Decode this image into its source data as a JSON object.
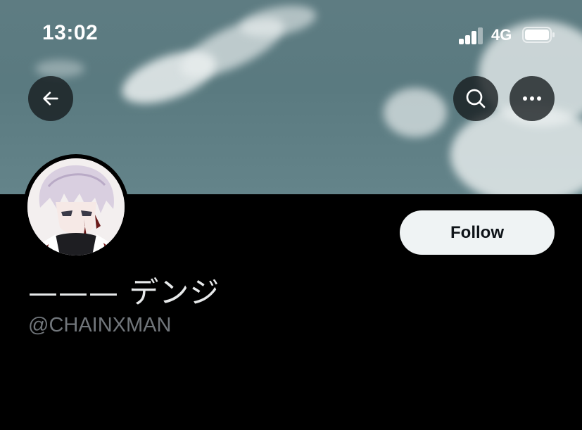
{
  "status_bar": {
    "time": "13:02",
    "network": "4G",
    "icons": [
      "signal-icon",
      "battery-icon"
    ]
  },
  "header": {
    "back_icon": "arrow-left-icon",
    "search_icon": "search-icon",
    "more_icon": "more-horizontal-icon"
  },
  "profile": {
    "display_name": "——— デンジ",
    "handle": "@CHAINXMAN",
    "follow_label": "Follow"
  },
  "colors": {
    "background": "#000000",
    "follow_button_bg": "#eff3f4",
    "follow_button_text": "#0f1419",
    "handle_text": "#71767b",
    "name_text": "#e7e9ea",
    "banner_sky": "#5e7c82"
  }
}
